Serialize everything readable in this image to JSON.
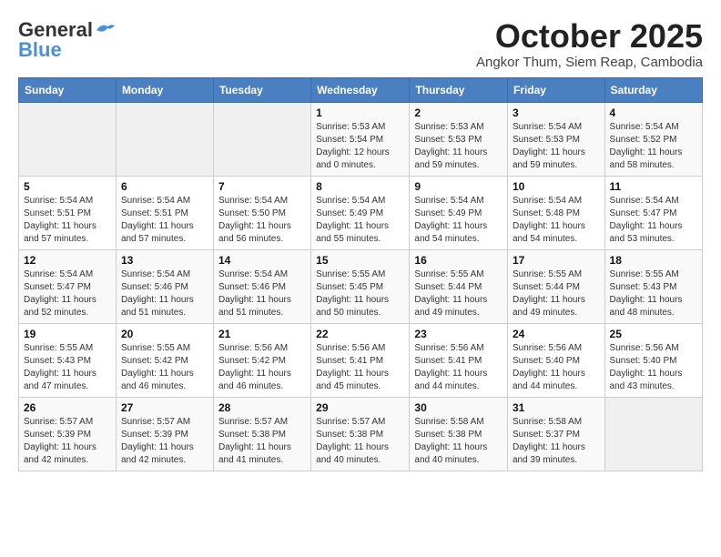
{
  "header": {
    "logo_line1": "General",
    "logo_line2": "Blue",
    "month": "October 2025",
    "location": "Angkor Thum, Siem Reap, Cambodia"
  },
  "weekdays": [
    "Sunday",
    "Monday",
    "Tuesday",
    "Wednesday",
    "Thursday",
    "Friday",
    "Saturday"
  ],
  "weeks": [
    [
      {
        "day": "",
        "sunrise": "",
        "sunset": "",
        "daylight": ""
      },
      {
        "day": "",
        "sunrise": "",
        "sunset": "",
        "daylight": ""
      },
      {
        "day": "",
        "sunrise": "",
        "sunset": "",
        "daylight": ""
      },
      {
        "day": "1",
        "sunrise": "Sunrise: 5:53 AM",
        "sunset": "Sunset: 5:54 PM",
        "daylight": "Daylight: 12 hours and 0 minutes."
      },
      {
        "day": "2",
        "sunrise": "Sunrise: 5:53 AM",
        "sunset": "Sunset: 5:53 PM",
        "daylight": "Daylight: 11 hours and 59 minutes."
      },
      {
        "day": "3",
        "sunrise": "Sunrise: 5:54 AM",
        "sunset": "Sunset: 5:53 PM",
        "daylight": "Daylight: 11 hours and 59 minutes."
      },
      {
        "day": "4",
        "sunrise": "Sunrise: 5:54 AM",
        "sunset": "Sunset: 5:52 PM",
        "daylight": "Daylight: 11 hours and 58 minutes."
      }
    ],
    [
      {
        "day": "5",
        "sunrise": "Sunrise: 5:54 AM",
        "sunset": "Sunset: 5:51 PM",
        "daylight": "Daylight: 11 hours and 57 minutes."
      },
      {
        "day": "6",
        "sunrise": "Sunrise: 5:54 AM",
        "sunset": "Sunset: 5:51 PM",
        "daylight": "Daylight: 11 hours and 57 minutes."
      },
      {
        "day": "7",
        "sunrise": "Sunrise: 5:54 AM",
        "sunset": "Sunset: 5:50 PM",
        "daylight": "Daylight: 11 hours and 56 minutes."
      },
      {
        "day": "8",
        "sunrise": "Sunrise: 5:54 AM",
        "sunset": "Sunset: 5:49 PM",
        "daylight": "Daylight: 11 hours and 55 minutes."
      },
      {
        "day": "9",
        "sunrise": "Sunrise: 5:54 AM",
        "sunset": "Sunset: 5:49 PM",
        "daylight": "Daylight: 11 hours and 54 minutes."
      },
      {
        "day": "10",
        "sunrise": "Sunrise: 5:54 AM",
        "sunset": "Sunset: 5:48 PM",
        "daylight": "Daylight: 11 hours and 54 minutes."
      },
      {
        "day": "11",
        "sunrise": "Sunrise: 5:54 AM",
        "sunset": "Sunset: 5:47 PM",
        "daylight": "Daylight: 11 hours and 53 minutes."
      }
    ],
    [
      {
        "day": "12",
        "sunrise": "Sunrise: 5:54 AM",
        "sunset": "Sunset: 5:47 PM",
        "daylight": "Daylight: 11 hours and 52 minutes."
      },
      {
        "day": "13",
        "sunrise": "Sunrise: 5:54 AM",
        "sunset": "Sunset: 5:46 PM",
        "daylight": "Daylight: 11 hours and 51 minutes."
      },
      {
        "day": "14",
        "sunrise": "Sunrise: 5:54 AM",
        "sunset": "Sunset: 5:46 PM",
        "daylight": "Daylight: 11 hours and 51 minutes."
      },
      {
        "day": "15",
        "sunrise": "Sunrise: 5:55 AM",
        "sunset": "Sunset: 5:45 PM",
        "daylight": "Daylight: 11 hours and 50 minutes."
      },
      {
        "day": "16",
        "sunrise": "Sunrise: 5:55 AM",
        "sunset": "Sunset: 5:44 PM",
        "daylight": "Daylight: 11 hours and 49 minutes."
      },
      {
        "day": "17",
        "sunrise": "Sunrise: 5:55 AM",
        "sunset": "Sunset: 5:44 PM",
        "daylight": "Daylight: 11 hours and 49 minutes."
      },
      {
        "day": "18",
        "sunrise": "Sunrise: 5:55 AM",
        "sunset": "Sunset: 5:43 PM",
        "daylight": "Daylight: 11 hours and 48 minutes."
      }
    ],
    [
      {
        "day": "19",
        "sunrise": "Sunrise: 5:55 AM",
        "sunset": "Sunset: 5:43 PM",
        "daylight": "Daylight: 11 hours and 47 minutes."
      },
      {
        "day": "20",
        "sunrise": "Sunrise: 5:55 AM",
        "sunset": "Sunset: 5:42 PM",
        "daylight": "Daylight: 11 hours and 46 minutes."
      },
      {
        "day": "21",
        "sunrise": "Sunrise: 5:56 AM",
        "sunset": "Sunset: 5:42 PM",
        "daylight": "Daylight: 11 hours and 46 minutes."
      },
      {
        "day": "22",
        "sunrise": "Sunrise: 5:56 AM",
        "sunset": "Sunset: 5:41 PM",
        "daylight": "Daylight: 11 hours and 45 minutes."
      },
      {
        "day": "23",
        "sunrise": "Sunrise: 5:56 AM",
        "sunset": "Sunset: 5:41 PM",
        "daylight": "Daylight: 11 hours and 44 minutes."
      },
      {
        "day": "24",
        "sunrise": "Sunrise: 5:56 AM",
        "sunset": "Sunset: 5:40 PM",
        "daylight": "Daylight: 11 hours and 44 minutes."
      },
      {
        "day": "25",
        "sunrise": "Sunrise: 5:56 AM",
        "sunset": "Sunset: 5:40 PM",
        "daylight": "Daylight: 11 hours and 43 minutes."
      }
    ],
    [
      {
        "day": "26",
        "sunrise": "Sunrise: 5:57 AM",
        "sunset": "Sunset: 5:39 PM",
        "daylight": "Daylight: 11 hours and 42 minutes."
      },
      {
        "day": "27",
        "sunrise": "Sunrise: 5:57 AM",
        "sunset": "Sunset: 5:39 PM",
        "daylight": "Daylight: 11 hours and 42 minutes."
      },
      {
        "day": "28",
        "sunrise": "Sunrise: 5:57 AM",
        "sunset": "Sunset: 5:38 PM",
        "daylight": "Daylight: 11 hours and 41 minutes."
      },
      {
        "day": "29",
        "sunrise": "Sunrise: 5:57 AM",
        "sunset": "Sunset: 5:38 PM",
        "daylight": "Daylight: 11 hours and 40 minutes."
      },
      {
        "day": "30",
        "sunrise": "Sunrise: 5:58 AM",
        "sunset": "Sunset: 5:38 PM",
        "daylight": "Daylight: 11 hours and 40 minutes."
      },
      {
        "day": "31",
        "sunrise": "Sunrise: 5:58 AM",
        "sunset": "Sunset: 5:37 PM",
        "daylight": "Daylight: 11 hours and 39 minutes."
      },
      {
        "day": "",
        "sunrise": "",
        "sunset": "",
        "daylight": ""
      }
    ]
  ]
}
